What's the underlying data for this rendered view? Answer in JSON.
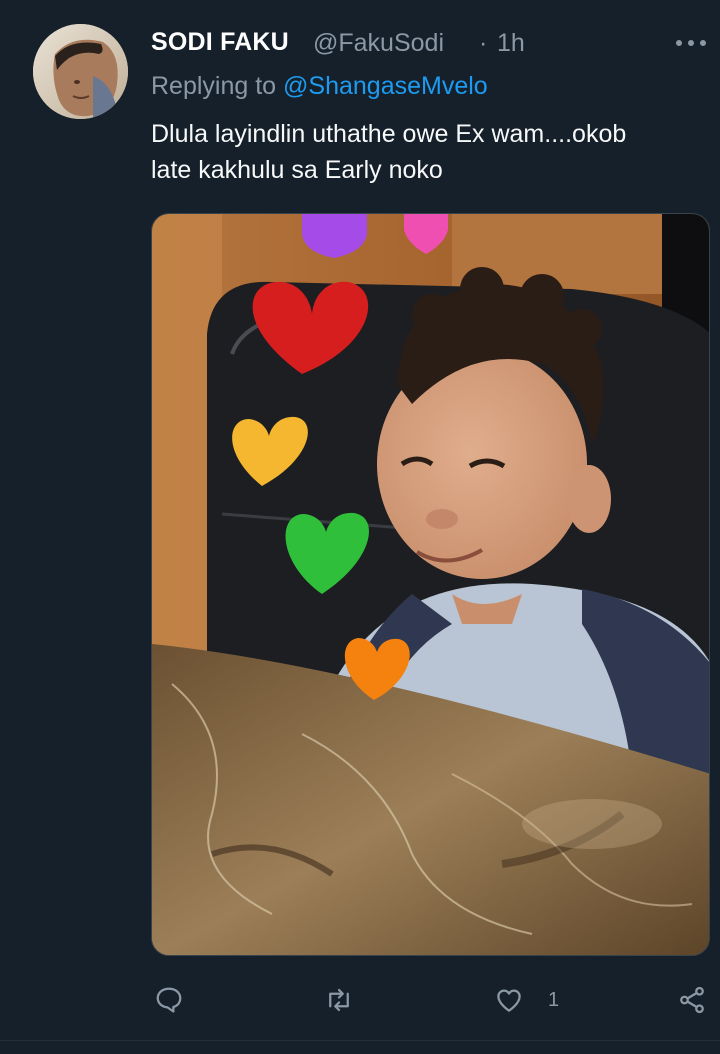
{
  "tweet": {
    "author_name": "SODI FAKU",
    "author_handle": "@FakuSodi",
    "separator": "·",
    "time": "1h",
    "replying_prefix": "Replying to",
    "replying_to": "@ShangaseMvelo",
    "text_line_1": "Dlula layindlin uthathe owe Ex wam....okob",
    "text_line_2": "late kakhulu sa Early noko",
    "media": {
      "description_icon": "photo-of-smiling-toddler-with-heart-emojis",
      "hearts": [
        "purple",
        "pink",
        "red",
        "yellow",
        "green",
        "orange"
      ]
    },
    "actions": {
      "reply_icon": "reply-icon",
      "retweet_icon": "retweet-icon",
      "like_icon": "heart-icon",
      "like_count": "1",
      "share_icon": "share-icon"
    }
  },
  "colors": {
    "background": "#15202b",
    "secondary_text": "#8b98a5",
    "link": "#1d9bf0",
    "primary_text": "#f7f9f9"
  }
}
